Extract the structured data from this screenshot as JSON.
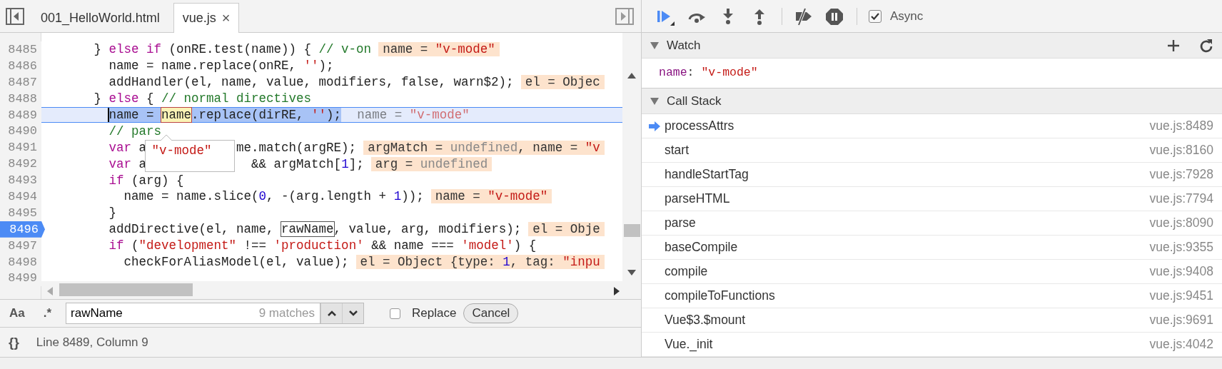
{
  "editor": {
    "tabs": [
      {
        "label": "001_HelloWorld.html",
        "selected": false
      },
      {
        "label": "vue.js",
        "selected": true,
        "close": "×"
      }
    ],
    "lines": [
      {
        "number": "8485",
        "breakpoint": false,
        "current": false,
        "tokens": [
          {
            "kind": "plain",
            "text": "      } "
          },
          {
            "kind": "keyword",
            "text": "else if"
          },
          {
            "kind": "plain",
            "text": " (onRE.test(name)) { "
          },
          {
            "kind": "comment",
            "text": "// v-on"
          }
        ],
        "value": [
          {
            "kind": "plain",
            "text": "name = "
          },
          {
            "kind": "string",
            "text": "\"v-mode\""
          }
        ]
      },
      {
        "number": "8486",
        "breakpoint": false,
        "current": false,
        "tokens": [
          {
            "kind": "plain",
            "text": "        name = name.replace(onRE, "
          },
          {
            "kind": "string",
            "text": "''"
          },
          {
            "kind": "plain",
            "text": ");"
          }
        ]
      },
      {
        "number": "8487",
        "breakpoint": false,
        "current": false,
        "tokens": [
          {
            "kind": "plain",
            "text": "        addHandler(el, name, value, modifiers, false, warn$2);"
          }
        ],
        "value": [
          {
            "kind": "plain",
            "text": "el = Objec"
          }
        ]
      },
      {
        "number": "8488",
        "breakpoint": false,
        "current": false,
        "tokens": [
          {
            "kind": "plain",
            "text": "      } "
          },
          {
            "kind": "keyword",
            "text": "else"
          },
          {
            "kind": "plain",
            "text": " { "
          },
          {
            "kind": "comment",
            "text": "// normal directives"
          }
        ]
      },
      {
        "number": "8489",
        "breakpoint": false,
        "current": true,
        "tokens": [
          {
            "kind": "selection",
            "text": "        name = "
          },
          {
            "kind": "match",
            "text": "name"
          },
          {
            "kind": "selection",
            "text": ".replace(dirRE, "
          },
          {
            "kind": "selection-string",
            "text": "''"
          },
          {
            "kind": "selection",
            "text": ");"
          }
        ],
        "value": [
          {
            "kind": "plain",
            "text": "name = "
          },
          {
            "kind": "string",
            "text": "\"v-mode\""
          }
        ]
      },
      {
        "number": "8490",
        "breakpoint": false,
        "current": false,
        "tokens": [
          {
            "kind": "comment",
            "text": "        // pars"
          }
        ]
      },
      {
        "number": "8491",
        "breakpoint": false,
        "current": false,
        "tokens": [
          {
            "kind": "keyword",
            "text": "        var"
          },
          {
            "kind": "plain",
            "text": " a"
          }
        ],
        "after": [
          {
            "kind": "plain",
            "text": "            me.match(argRE);"
          }
        ],
        "value": [
          {
            "kind": "plain",
            "text": "argMatch = "
          },
          {
            "kind": "undefined",
            "text": "undefined"
          },
          {
            "kind": "plain",
            "text": ", name = "
          },
          {
            "kind": "string",
            "text": "\"v"
          }
        ]
      },
      {
        "number": "8492",
        "breakpoint": false,
        "current": false,
        "tokens": [
          {
            "kind": "keyword",
            "text": "        var"
          },
          {
            "kind": "plain",
            "text": " a"
          }
        ],
        "after": [
          {
            "kind": "plain",
            "text": "              && argMatch["
          },
          {
            "kind": "number",
            "text": "1"
          },
          {
            "kind": "plain",
            "text": "];"
          }
        ],
        "value": [
          {
            "kind": "plain",
            "text": "arg = "
          },
          {
            "kind": "undefined",
            "text": "undefined"
          }
        ]
      },
      {
        "number": "8493",
        "breakpoint": false,
        "current": false,
        "tokens": [
          {
            "kind": "keyword",
            "text": "        if"
          },
          {
            "kind": "plain",
            "text": " (arg) {"
          }
        ]
      },
      {
        "number": "8494",
        "breakpoint": false,
        "current": false,
        "tokens": [
          {
            "kind": "plain",
            "text": "          name = name.slice("
          },
          {
            "kind": "number",
            "text": "0"
          },
          {
            "kind": "plain",
            "text": ", -(arg.length + "
          },
          {
            "kind": "number",
            "text": "1"
          },
          {
            "kind": "plain",
            "text": "));"
          }
        ],
        "value": [
          {
            "kind": "plain",
            "text": "name = "
          },
          {
            "kind": "string",
            "text": "\"v-mode\""
          }
        ]
      },
      {
        "number": "8495",
        "breakpoint": false,
        "current": false,
        "tokens": [
          {
            "kind": "plain",
            "text": "        }"
          }
        ]
      },
      {
        "number": "8496",
        "breakpoint": true,
        "current": false,
        "tokens": [
          {
            "kind": "plain",
            "text": "        addDirective(el, name, "
          },
          {
            "kind": "boxed",
            "text": "rawName"
          },
          {
            "kind": "plain",
            "text": ", value, arg, modifiers);"
          }
        ],
        "value": [
          {
            "kind": "plain",
            "text": "el = Obje"
          }
        ]
      },
      {
        "number": "8497",
        "breakpoint": false,
        "current": false,
        "tokens": [
          {
            "kind": "keyword",
            "text": "        if"
          },
          {
            "kind": "plain",
            "text": " ("
          },
          {
            "kind": "string",
            "text": "\"development\""
          },
          {
            "kind": "plain",
            "text": " !== "
          },
          {
            "kind": "string",
            "text": "'production'"
          },
          {
            "kind": "plain",
            "text": " && name === "
          },
          {
            "kind": "string",
            "text": "'model'"
          },
          {
            "kind": "plain",
            "text": ") {"
          }
        ]
      },
      {
        "number": "8498",
        "breakpoint": false,
        "current": false,
        "tokens": [
          {
            "kind": "plain",
            "text": "          checkForAliasModel(el, value);"
          }
        ],
        "value": [
          {
            "kind": "plain",
            "text": "el = Object {type: "
          },
          {
            "kind": "number",
            "text": "1"
          },
          {
            "kind": "plain",
            "text": ", tag: "
          },
          {
            "kind": "string",
            "text": "\"inpu"
          }
        ]
      },
      {
        "number": "8499",
        "breakpoint": false,
        "current": false
      }
    ],
    "popover": {
      "value": "\"v-mode\""
    },
    "search": {
      "case_toggle": "Aa",
      "regex_toggle": ".*",
      "value": "rawName",
      "matches": "9 matches",
      "replace": {
        "label": "Replace",
        "checked": false
      },
      "cancel": "Cancel"
    },
    "status": {
      "format_button": "{}",
      "position": "Line 8489, Column 9"
    }
  },
  "debugger": {
    "async": {
      "label": "Async",
      "checked": true
    },
    "watch": {
      "title": "Watch",
      "expanded": true,
      "items": [
        {
          "key": "name",
          "separator": ": ",
          "value": "\"v-mode\""
        }
      ]
    },
    "call_stack": {
      "title": "Call Stack",
      "expanded": true,
      "frames": [
        {
          "name": "processAttrs",
          "location": "vue.js:8489",
          "current": true
        },
        {
          "name": "start",
          "location": "vue.js:8160",
          "current": false
        },
        {
          "name": "handleStartTag",
          "location": "vue.js:7928",
          "current": false
        },
        {
          "name": "parseHTML",
          "location": "vue.js:7794",
          "current": false
        },
        {
          "name": "parse",
          "location": "vue.js:8090",
          "current": false
        },
        {
          "name": "baseCompile",
          "location": "vue.js:9355",
          "current": false
        },
        {
          "name": "compile",
          "location": "vue.js:9408",
          "current": false
        },
        {
          "name": "compileToFunctions",
          "location": "vue.js:9451",
          "current": false
        },
        {
          "name": "Vue$3.$mount",
          "location": "vue.js:9691",
          "current": false
        },
        {
          "name": "Vue._init",
          "location": "vue.js:4042",
          "current": false
        }
      ]
    }
  }
}
